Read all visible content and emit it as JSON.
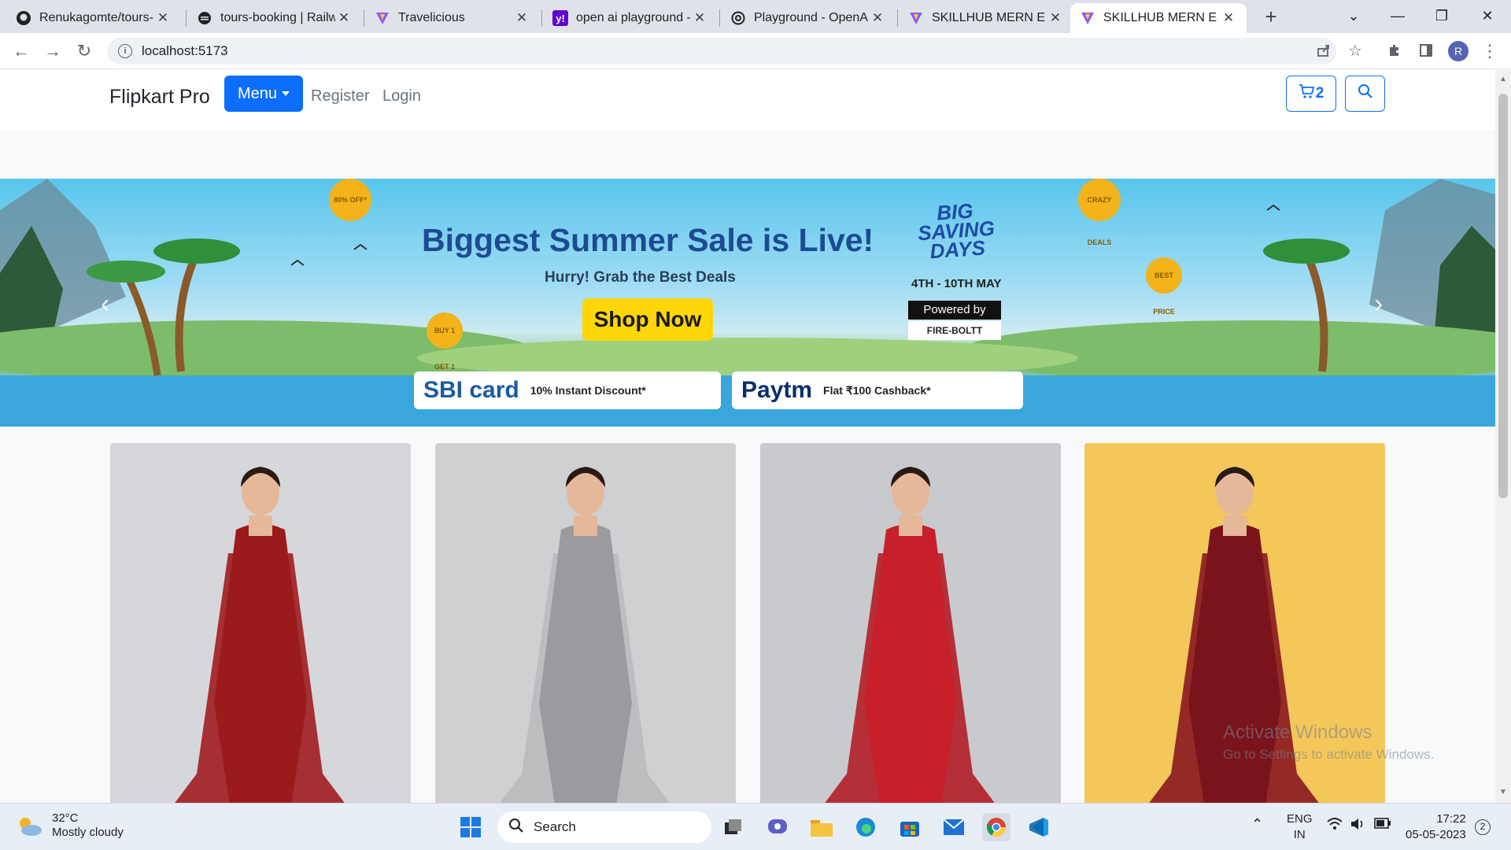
{
  "browser": {
    "tabs": [
      {
        "title": "Renukagomte/tours-b",
        "icon": "github-icon",
        "active": false
      },
      {
        "title": "tours-booking | Railw",
        "icon": "railway-icon",
        "active": false
      },
      {
        "title": "Travelicious",
        "icon": "vite-icon",
        "active": false
      },
      {
        "title": "open ai playground -",
        "icon": "yahoo-icon",
        "active": false
      },
      {
        "title": "Playground - OpenAI",
        "icon": "openai-icon",
        "active": false
      },
      {
        "title": "SKILLHUB MERN E CO",
        "icon": "vite-icon",
        "active": false
      },
      {
        "title": "SKILLHUB MERN E CO",
        "icon": "vite-icon",
        "active": true
      }
    ],
    "url": "localhost:5173",
    "profile_initial": "R"
  },
  "navbar": {
    "brand": "Flipkart Pro",
    "menu_label": "Menu",
    "register_label": "Register",
    "login_label": "Login",
    "cart_count": "2"
  },
  "banner": {
    "title": "Biggest Summer Sale is Live!",
    "subtitle": "Hurry! Grab the Best Deals",
    "cta": "Shop Now",
    "event_line1": "BIG",
    "event_line2": "SAVING",
    "event_line3": "DAYS",
    "dates": "4TH - 10TH MAY",
    "powered_by": "Powered by",
    "sponsor": "FIRE-BOLTT",
    "offers": [
      {
        "brand": "SBI card",
        "text": "10% Instant Discount*",
        "color": "#1a5aa6"
      },
      {
        "brand": "Paytm",
        "text": "Flat ₹100 Cashback*",
        "color": "#0c2e6e"
      }
    ],
    "coin_labels": [
      "80% OFF*",
      "CRAZY DEALS",
      "BUY 1 GET 1",
      "BEST PRICE"
    ]
  },
  "products": [
    {
      "name": "product-card-1",
      "bg": "#d6d7da",
      "dress": "#9b1a1c",
      "scarf": "#a01d1f"
    },
    {
      "name": "product-card-2",
      "bg": "#cfd0d2",
      "dress": "#9a9b9f",
      "scarf": "#b9babd"
    },
    {
      "name": "product-card-3",
      "bg": "#c9cacd",
      "dress": "#c7202b",
      "scarf": "#b21e28"
    },
    {
      "name": "product-card-4",
      "bg": "#f4c75a",
      "dress": "#7a141c",
      "scarf": "#8a1820"
    }
  ],
  "watermark": {
    "line1": "Activate Windows",
    "line2": "Go to Settings to activate Windows."
  },
  "taskbar": {
    "temperature": "32°C",
    "weather": "Mostly cloudy",
    "search_placeholder": "Search",
    "language": "ENG",
    "region": "IN",
    "time": "17:22",
    "date": "05-05-2023",
    "notifications": "2"
  }
}
